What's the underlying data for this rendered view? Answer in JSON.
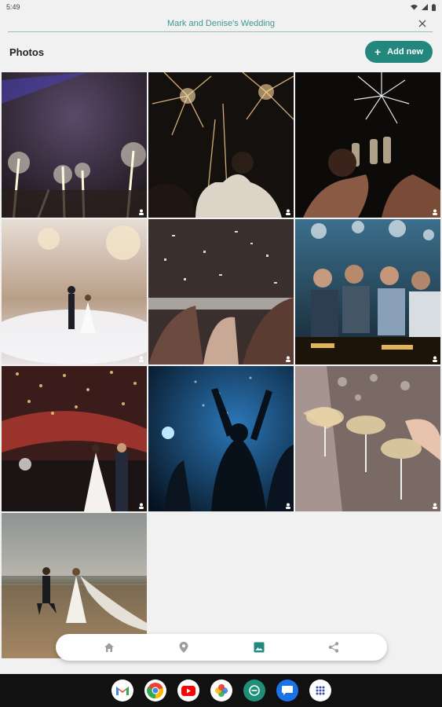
{
  "status_bar": {
    "time": "5:49"
  },
  "event": {
    "title": "Mark and Denise's Wedding"
  },
  "photos_section": {
    "title": "Photos",
    "add_button_label": "Add new",
    "add_icon": "+"
  },
  "photos": [
    {
      "subject": "sparklers-raised"
    },
    {
      "subject": "fireworks-crowd"
    },
    {
      "subject": "champagne-toast-fireworks"
    },
    {
      "subject": "first-dance-fog"
    },
    {
      "subject": "confetti-party"
    },
    {
      "subject": "friends-toasting"
    },
    {
      "subject": "confetti-couple-dance"
    },
    {
      "subject": "dancing-silhouettes"
    },
    {
      "subject": "champagne-coupes"
    },
    {
      "subject": "couple-running-field"
    }
  ],
  "bottom_nav": {
    "items": [
      {
        "icon": "home-icon",
        "active": false
      },
      {
        "icon": "location-pin-icon",
        "active": false
      },
      {
        "icon": "photos-icon",
        "active": true
      },
      {
        "icon": "share-icon",
        "active": false
      }
    ]
  },
  "dock_apps": [
    "gmail-icon",
    "chrome-icon",
    "youtube-icon",
    "photos-app-icon",
    "messages-green-icon",
    "messages-blue-icon",
    "app-drawer-icon"
  ],
  "colors": {
    "accent": "#23877d",
    "title": "#3a9a8d",
    "nav_active": "#23877d",
    "nav_inactive": "#9e9e9e"
  }
}
